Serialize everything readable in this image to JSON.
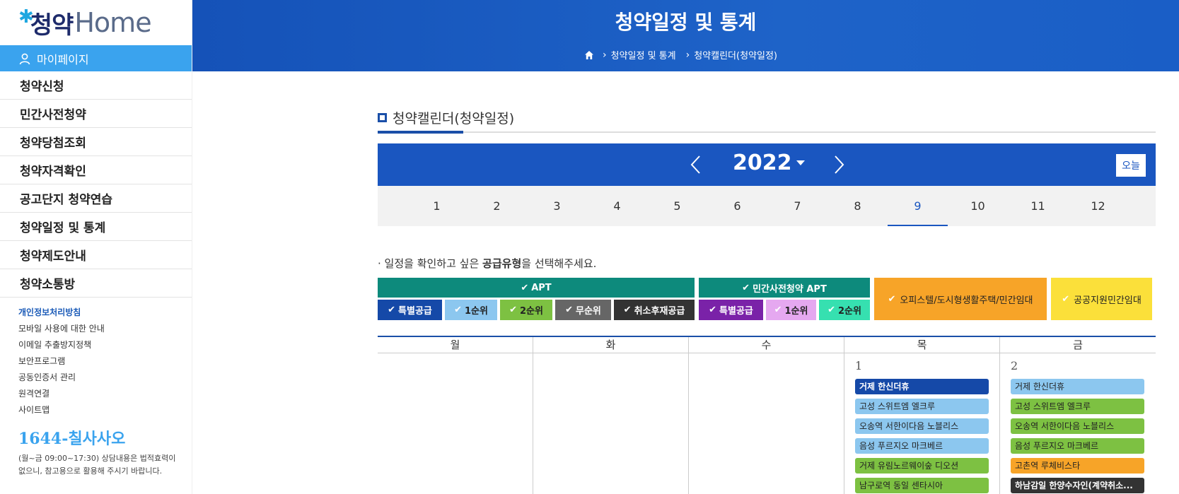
{
  "sidebar": {
    "logo_star": "✱",
    "logo_ko": "청약",
    "logo_en": "Home",
    "mypage_label": "마이페이지",
    "nav": [
      "청약신청",
      "민간사전청약",
      "청약당첨조회",
      "청약자격확인",
      "공고단지 청약연습",
      "청약일정 및 통계",
      "청약제도안내",
      "청약소통방"
    ],
    "sub_links": [
      "개인정보처리방침",
      "모바일 사용에 대한 안내",
      "이메일 추출방지정책",
      "보안프로그램",
      "공동인증서 관리",
      "원격연결",
      "사이트맵"
    ],
    "phone": "1644-칠사사오",
    "phone_note": "(월~금 09:00~17:30) 상담내용은 법적효력이 없으니, 참고용으로 활용해 주시기 바랍니다."
  },
  "header": {
    "title": "청약일정 및 통계",
    "breadcrumb": [
      "청약일정 및 통계",
      "청약캘린더(청약일정)"
    ]
  },
  "section": {
    "title": "청약캘린더(청약일정)"
  },
  "calendar_nav": {
    "year": "2022",
    "today_label": "오늘",
    "months": [
      "1",
      "2",
      "3",
      "4",
      "5",
      "6",
      "7",
      "8",
      "9",
      "10",
      "11",
      "12"
    ],
    "active_month": "9"
  },
  "instruction": {
    "prefix": "· 일정을 확인하고 싶은 ",
    "bold": "공급유형",
    "suffix": "을 선택해주세요."
  },
  "filters": {
    "check": "✔",
    "apt": {
      "label": "APT",
      "color": "#0d8a7c",
      "chips": [
        {
          "label": "특별공급",
          "color": "#1549a8",
          "text": "#ffffff"
        },
        {
          "label": "1순위",
          "color": "#8cc7ef",
          "text": "#222222"
        },
        {
          "label": "2순위",
          "color": "#7dc142",
          "text": "#222222"
        },
        {
          "label": "무순위",
          "color": "#666666",
          "text": "#ffffff"
        },
        {
          "label": "취소후재공급",
          "color": "#333333",
          "text": "#ffffff"
        }
      ]
    },
    "private": {
      "label": "민간사전청약 APT",
      "color": "#0d8a7c",
      "chips": [
        {
          "label": "특별공급",
          "color": "#7a22a8",
          "text": "#ffffff"
        },
        {
          "label": "1순위",
          "color": "#e5a8f0",
          "text": "#222222"
        },
        {
          "label": "2순위",
          "color": "#36e0b0",
          "text": "#222222"
        }
      ]
    },
    "officetel": {
      "label": "오피스텔/도시형생활주택/민간임대",
      "color": "#f7a428"
    },
    "public_rent": {
      "label": "공공지원민간임대",
      "color": "#fbe03a"
    }
  },
  "calendar": {
    "days": [
      "월",
      "화",
      "수",
      "목",
      "금"
    ],
    "cells": [
      {
        "num": "",
        "events": []
      },
      {
        "num": "",
        "events": []
      },
      {
        "num": "",
        "events": []
      },
      {
        "num": "1",
        "events": [
          {
            "label": "거제 한신더휴",
            "color": "#1549a8",
            "text": "#ffffff"
          },
          {
            "label": "고성 스위트엠 엘크루",
            "color": "#8cc7ef",
            "text": "#222222"
          },
          {
            "label": "오송역 서한이다음 노블리스",
            "color": "#8cc7ef",
            "text": "#222222"
          },
          {
            "label": "음성 푸르지오 마크베르",
            "color": "#8cc7ef",
            "text": "#222222"
          },
          {
            "label": "거제 유림노르웨이숲 디오션",
            "color": "#7dc142",
            "text": "#222222"
          },
          {
            "label": "남구로역 동일 센타시아",
            "color": "#7dc142",
            "text": "#222222"
          }
        ]
      },
      {
        "num": "2",
        "events": [
          {
            "label": "거제 한신더휴",
            "color": "#8cc7ef",
            "text": "#222222"
          },
          {
            "label": "고성 스위트엠 엘크루",
            "color": "#7dc142",
            "text": "#222222"
          },
          {
            "label": "오송역 서한이다음 노블리스",
            "color": "#7dc142",
            "text": "#222222"
          },
          {
            "label": "음성 푸르지오 마크베르",
            "color": "#7dc142",
            "text": "#222222"
          },
          {
            "label": "고촌역 루체비스타",
            "color": "#f7a428",
            "text": "#222222"
          },
          {
            "label": "하남감일 한양수자인(계약취소...",
            "color": "#333333",
            "text": "#ffffff"
          }
        ]
      }
    ]
  }
}
